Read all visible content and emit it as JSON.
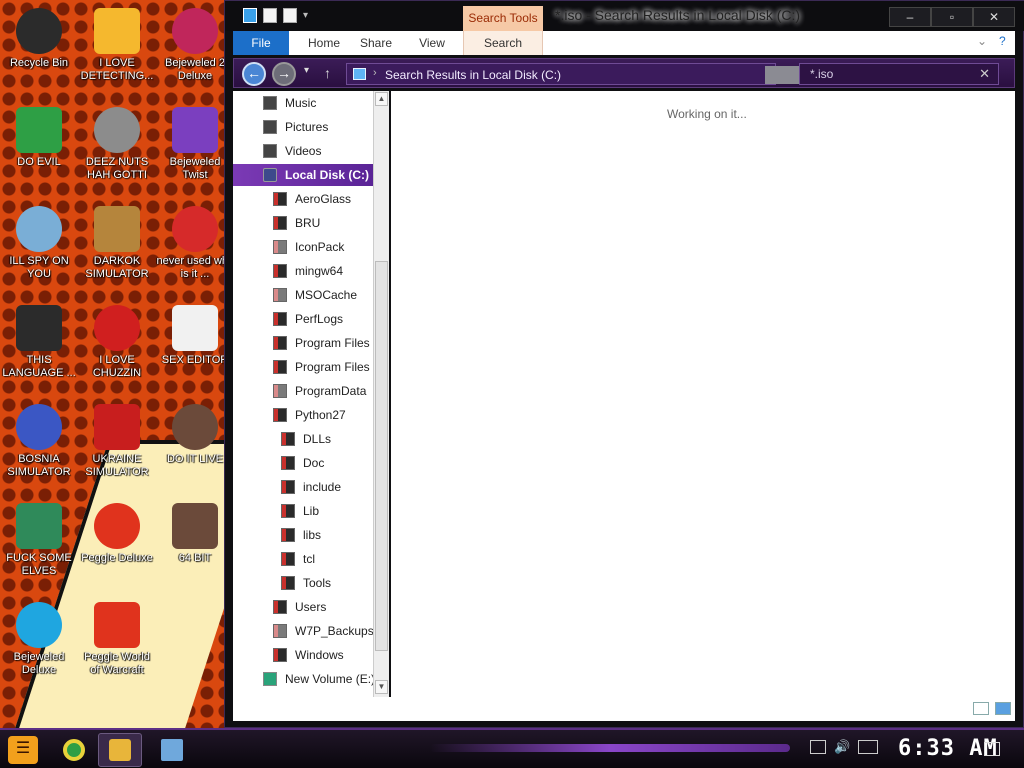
{
  "desktop": {
    "icons": [
      {
        "label": "Recycle Bin",
        "icon": "recycle-bin-icon",
        "color": "#2b2b2b"
      },
      {
        "label": "I LOVE DETECTING...",
        "icon": "de-icon",
        "color": "#f5b82e"
      },
      {
        "label": "Bejeweled 2 Deluxe",
        "icon": "bejeweled-icon",
        "color": "#c0265b"
      },
      {
        "label": "DO EVIL",
        "icon": "chrome-icon",
        "color": "#2e9f45"
      },
      {
        "label": "DEEZ NUTS HAH GOTTI",
        "icon": "copy-icon",
        "color": "#8c8c8c"
      },
      {
        "label": "Bejeweled Twist",
        "icon": "gem-icon",
        "color": "#7b3fbf"
      },
      {
        "label": "ILL SPY ON YOU",
        "icon": "spy-icon",
        "color": "#7aaed6"
      },
      {
        "label": "DARKOK SIMULATOR",
        "icon": "money-bag-icon",
        "color": "#b5853c"
      },
      {
        "label": "never used why is it ...",
        "icon": "devcpp-icon",
        "color": "#d62a2a"
      },
      {
        "label": "THIS LANGUAGE ...",
        "icon": "go-icon",
        "color": "#2b2b2b"
      },
      {
        "label": "I LOVE CHUZZIN",
        "icon": "chuzzle-icon",
        "color": "#d01f1f"
      },
      {
        "label": "SEX EDITOR",
        "icon": "hxd-icon",
        "color": "#f1f1f1"
      },
      {
        "label": "BOSNIA SIMULATOR",
        "icon": "mine-icon",
        "color": "#3b57c4"
      },
      {
        "label": "UKRAINE SIMULATOR",
        "icon": "radiation-icon",
        "color": "#c81e1e"
      },
      {
        "label": "DO IT LIVE",
        "icon": "portrait-icon",
        "color": "#6b4a3a"
      },
      {
        "label": "FUCK SOME ELVES",
        "icon": "santa-icon",
        "color": "#2f8a5a"
      },
      {
        "label": "Peggle Deluxe",
        "icon": "peggle-icon",
        "color": "#e0331d"
      },
      {
        "label": "64 BIT",
        "icon": "portrait-icon",
        "color": "#6b4a3a"
      },
      {
        "label": "Bejeweled Deluxe",
        "icon": "diamond-icon",
        "color": "#1fa6e0"
      },
      {
        "label": "Peggle World of Warcraft Edition",
        "icon": "peggle-icon",
        "color": "#e0331d"
      }
    ]
  },
  "window": {
    "title": "*.iso - Search Results in Local Disk (C:)",
    "context_tab": "Search Tools",
    "buttons": {
      "minimize": "–",
      "maximize": "▫",
      "close": "✕"
    },
    "ribbon_tabs": [
      "File",
      "Home",
      "Share",
      "View",
      "Search"
    ],
    "address": {
      "path": "Search Results in Local Disk (C:)"
    },
    "search": {
      "value": "*.iso",
      "clear": "✕"
    },
    "status_message": "Working on it...",
    "nav_items": [
      {
        "label": "Music",
        "icon": "library",
        "level": 1
      },
      {
        "label": "Pictures",
        "icon": "library",
        "level": 1
      },
      {
        "label": "Videos",
        "icon": "library",
        "level": 1
      },
      {
        "label": "Local Disk (C:)",
        "icon": "drive",
        "level": 1,
        "selected": true
      },
      {
        "label": "AeroGlass",
        "icon": "folder",
        "level": 2
      },
      {
        "label": "BRU",
        "icon": "folder",
        "level": 2
      },
      {
        "label": "IconPack",
        "icon": "folder-light",
        "level": 2
      },
      {
        "label": "mingw64",
        "icon": "folder",
        "level": 2
      },
      {
        "label": "MSOCache",
        "icon": "folder-light",
        "level": 2
      },
      {
        "label": "PerfLogs",
        "icon": "folder",
        "level": 2
      },
      {
        "label": "Program Files",
        "icon": "folder",
        "level": 2
      },
      {
        "label": "Program Files (x",
        "icon": "folder",
        "level": 2
      },
      {
        "label": "ProgramData",
        "icon": "folder-light",
        "level": 2
      },
      {
        "label": "Python27",
        "icon": "folder",
        "level": 2
      },
      {
        "label": "DLLs",
        "icon": "folder",
        "level": 3
      },
      {
        "label": "Doc",
        "icon": "folder",
        "level": 3
      },
      {
        "label": "include",
        "icon": "folder",
        "level": 3
      },
      {
        "label": "Lib",
        "icon": "folder",
        "level": 3
      },
      {
        "label": "libs",
        "icon": "folder",
        "level": 3
      },
      {
        "label": "tcl",
        "icon": "folder",
        "level": 3
      },
      {
        "label": "Tools",
        "icon": "folder",
        "level": 3
      },
      {
        "label": "Users",
        "icon": "folder",
        "level": 2
      },
      {
        "label": "W7P_Backups",
        "icon": "folder-light",
        "level": 2
      },
      {
        "label": "Windows",
        "icon": "folder",
        "level": 2
      },
      {
        "label": "New Volume (E:)",
        "icon": "volume",
        "level": 1
      }
    ]
  },
  "taskbar": {
    "clock": "6:33 AM",
    "start_label": "☰",
    "pinned": [
      {
        "icon": "chrome-icon",
        "color": "#2e9f45"
      },
      {
        "icon": "explorer-icon",
        "color": "#e8b53a"
      },
      {
        "icon": "computer-icon",
        "color": "#6fa8dc"
      }
    ]
  },
  "colors": {
    "accent": "#7b3ab5",
    "file_tab": "#1c6fc9",
    "context_tab": "#f6c9a6"
  }
}
